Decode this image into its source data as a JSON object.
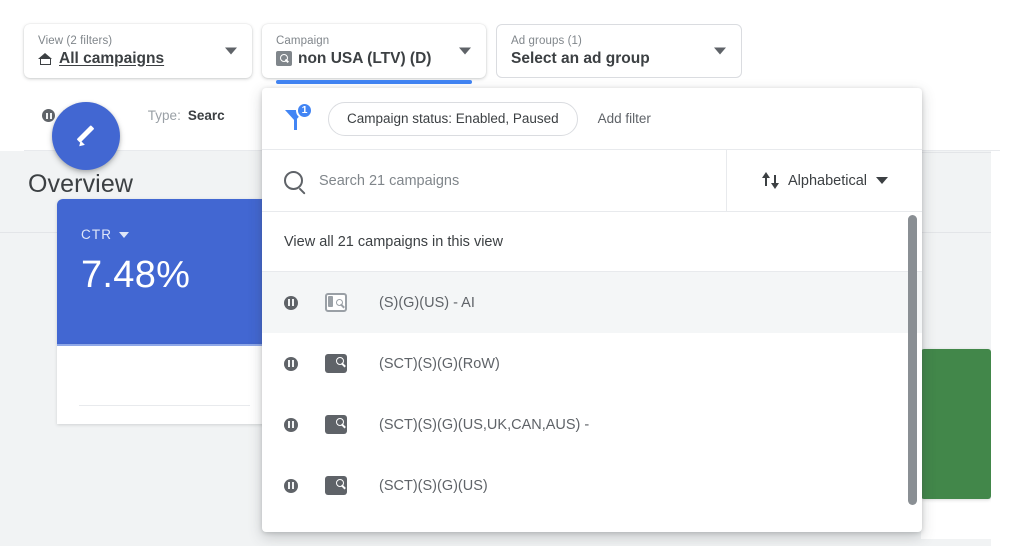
{
  "selectors": [
    {
      "label": "View (2 filters)",
      "value": "All campaigns",
      "icon": "home-icon",
      "style": "card",
      "underlined_text": true,
      "active": false
    },
    {
      "label": "Campaign",
      "value": "non USA (LTV) (D)",
      "icon": "campaign-search-icon",
      "style": "card",
      "underlined_text": false,
      "active": true
    },
    {
      "label": "Ad groups (1)",
      "value": "Select an ad group",
      "icon": "",
      "style": "outline",
      "underlined_text": false,
      "active": false
    }
  ],
  "status_strip": {
    "state_label": "Paused",
    "type_label_prefix": "Type: ",
    "type_label_value": "Searc"
  },
  "overview": {
    "title": "Overview",
    "edit_button_label": "Edit"
  },
  "metric_card": {
    "label": "CTR",
    "value": "7.48%"
  },
  "dropdown": {
    "filter_bar": {
      "badge_count": "1",
      "chip_label": "Campaign status: Enabled, Paused",
      "add_filter_label": "Add filter"
    },
    "search": {
      "placeholder": "Search 21 campaigns",
      "value": ""
    },
    "sort": {
      "label": "Alphabetical"
    },
    "view_all_label": "View all 21 campaigns in this view",
    "rows": [
      {
        "status": "paused",
        "type_icon": "display-search-icon",
        "icon_style": "outlined",
        "label": "(S)(G)(US) - AI",
        "hover": true
      },
      {
        "status": "paused",
        "type_icon": "search-icon",
        "icon_style": "solid",
        "label": "(SCT)(S)(G)(RoW)",
        "hover": false
      },
      {
        "status": "paused",
        "type_icon": "search-icon",
        "icon_style": "solid",
        "label": "(SCT)(S)(G)(US,UK,CAN,AUS) -",
        "hover": false
      },
      {
        "status": "paused",
        "type_icon": "search-icon",
        "icon_style": "solid",
        "label": "(SCT)(S)(G)(US)",
        "hover": false
      }
    ]
  },
  "colors": {
    "accent_blue": "#4285f4",
    "card_blue": "#4267d2",
    "card_green": "#42874a",
    "text_primary": "#3c4043",
    "text_secondary": "#5f6368",
    "text_muted": "#80868b",
    "surface_gray": "#f1f3f4",
    "divider": "#e8eaed"
  }
}
